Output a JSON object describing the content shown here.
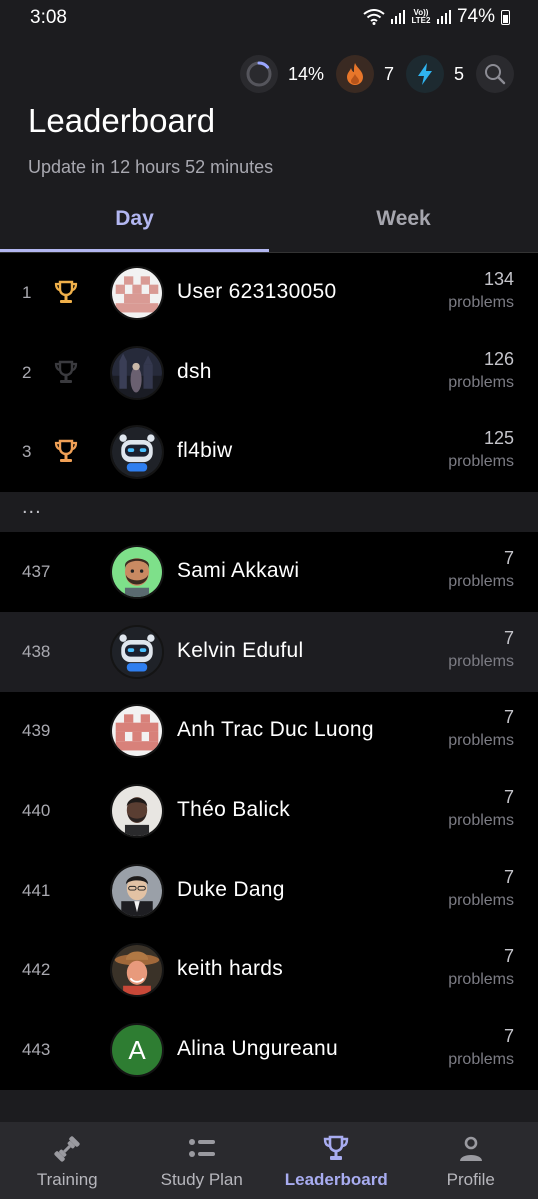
{
  "status_bar": {
    "time": "3:08",
    "battery": "74%",
    "network_label": "Vo)) LTE2"
  },
  "stats": {
    "progress": "14%",
    "progress_value": 0.14,
    "streak": "7",
    "energy": "5"
  },
  "header": {
    "title": "Leaderboard",
    "update_text": "Update in 12 hours 52 minutes"
  },
  "tabs": [
    {
      "label": "Day"
    },
    {
      "label": "Week"
    }
  ],
  "leaderboard": {
    "top": [
      {
        "rank": "1",
        "name": "User 623130050",
        "score": "134",
        "unit": "problems",
        "trophy": "gold"
      },
      {
        "rank": "2",
        "name": "dsh",
        "score": "126",
        "unit": "problems",
        "trophy": "silver"
      },
      {
        "rank": "3",
        "name": "fl4biw",
        "score": "125",
        "unit": "problems",
        "trophy": "bronze"
      }
    ],
    "separator": "...",
    "nearby": [
      {
        "rank": "437",
        "name": "Sami Akkawi",
        "score": "7",
        "unit": "problems"
      },
      {
        "rank": "438",
        "name": "Kelvin Eduful",
        "score": "7",
        "unit": "problems"
      },
      {
        "rank": "439",
        "name": "Anh Trac Duc Luong",
        "score": "7",
        "unit": "problems"
      },
      {
        "rank": "440",
        "name": "Théo Balick",
        "score": "7",
        "unit": "problems"
      },
      {
        "rank": "441",
        "name": "Duke Dang",
        "score": "7",
        "unit": "problems"
      },
      {
        "rank": "442",
        "name": "keith hards",
        "score": "7",
        "unit": "problems"
      },
      {
        "rank": "443",
        "name": "Alina Ungureanu",
        "score": "7",
        "unit": "problems",
        "avatar_letter": "A"
      }
    ]
  },
  "nav": [
    {
      "label": "Training",
      "icon": "dumbbell-icon"
    },
    {
      "label": "Study Plan",
      "icon": "list-icon"
    },
    {
      "label": "Leaderboard",
      "icon": "trophy-icon",
      "active": true
    },
    {
      "label": "Profile",
      "icon": "person-icon"
    }
  ],
  "colors": {
    "accent": "#b2b6f0",
    "gold": "#f0b04a",
    "bronze": "#f0a056",
    "flame": "#e8762a",
    "bolt": "#2fb4f0"
  }
}
